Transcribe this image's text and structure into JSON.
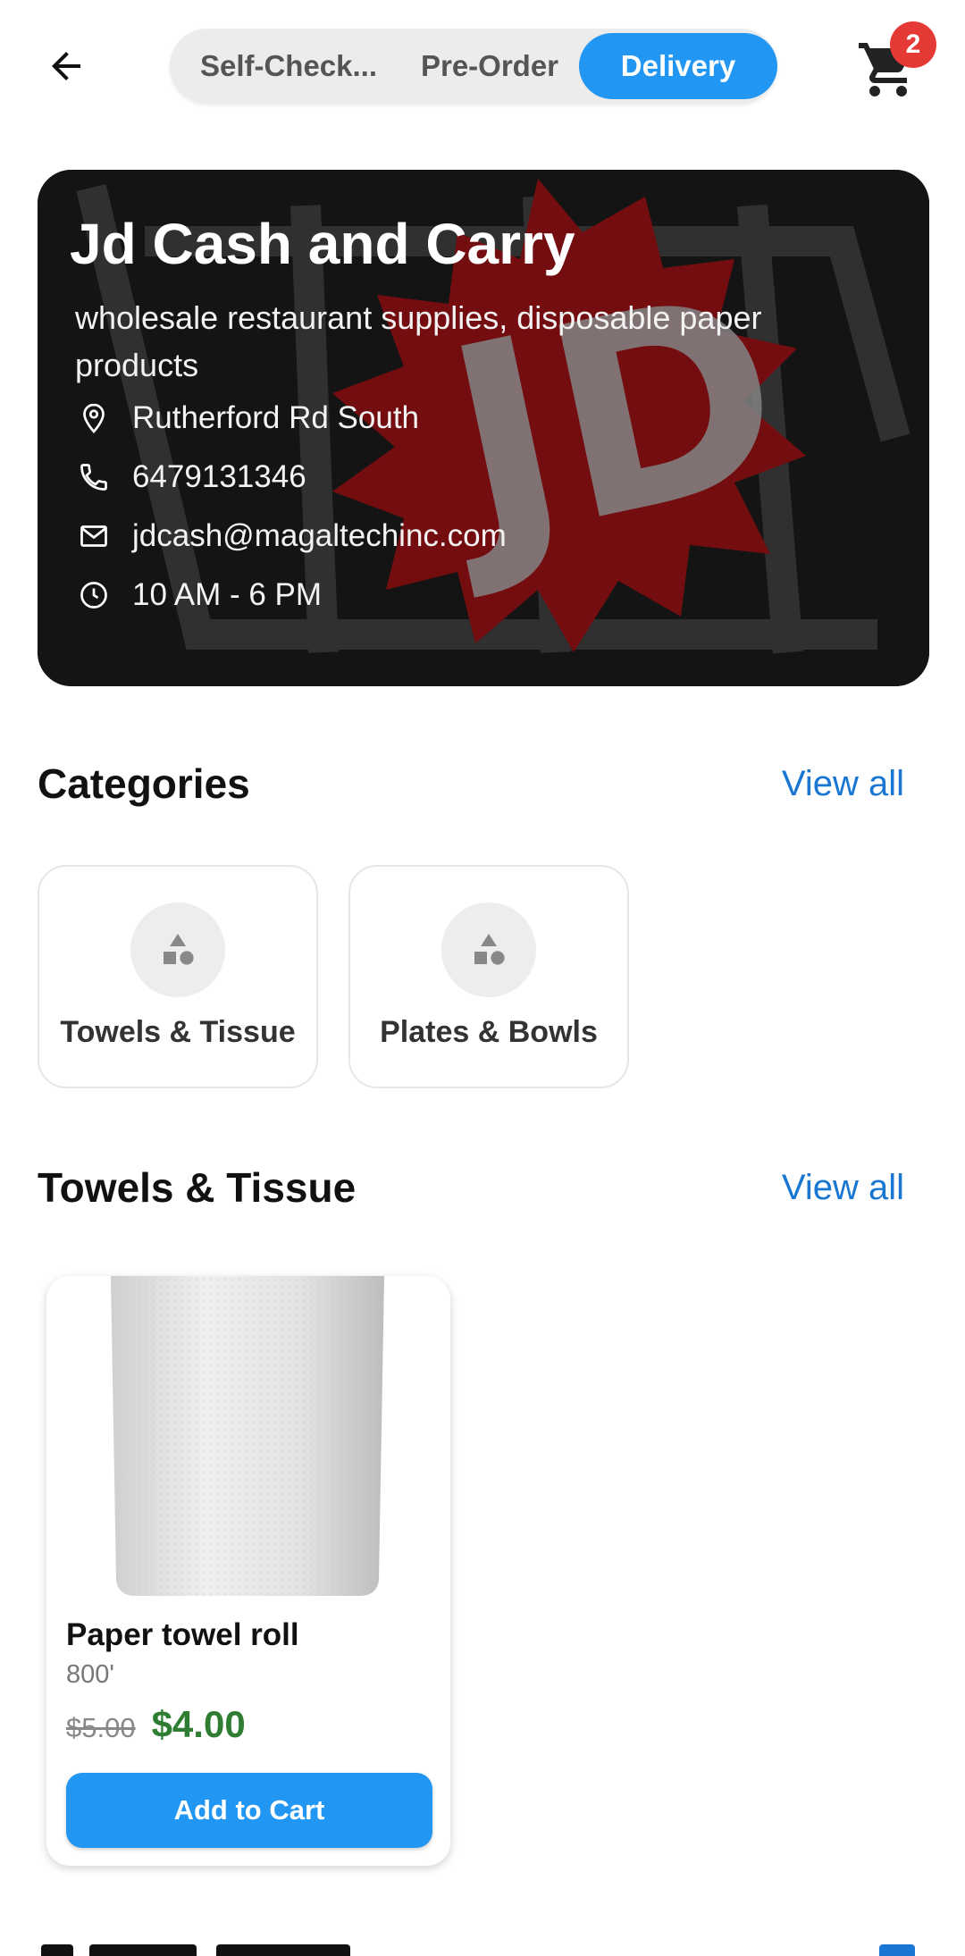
{
  "top_bar": {
    "back_icon": "arrow-left-icon",
    "modes": [
      {
        "label": "Self-Check...",
        "active": false
      },
      {
        "label": "Pre-Order",
        "active": false
      },
      {
        "label": "Delivery",
        "active": true
      }
    ],
    "cart_icon": "shopping-cart-icon",
    "cart_count": "2"
  },
  "store": {
    "name": "Jd Cash and Carry",
    "description": "wholesale restaurant supplies, disposable paper products",
    "address": "Rutherford Rd South",
    "phone": "6479131346",
    "email": "jdcash@magaltechinc.com",
    "hours": "10 AM - 6 PM"
  },
  "categories": {
    "title": "Categories",
    "view_all": "View all",
    "items": [
      {
        "label": "Towels & Tissue",
        "icon": "category-shapes-icon"
      },
      {
        "label": "Plates & Bowls",
        "icon": "category-shapes-icon"
      }
    ]
  },
  "towels_section": {
    "title": "Towels & Tissue",
    "view_all": "View all",
    "products": [
      {
        "name": "Paper towel roll",
        "size": "800'",
        "old_price": "$5.00",
        "price": "$4.00",
        "button": "Add to Cart"
      }
    ]
  },
  "colors": {
    "accent": "#2196F3",
    "badge": "#e53935",
    "price": "#2e7d32",
    "link": "#1976D2"
  }
}
